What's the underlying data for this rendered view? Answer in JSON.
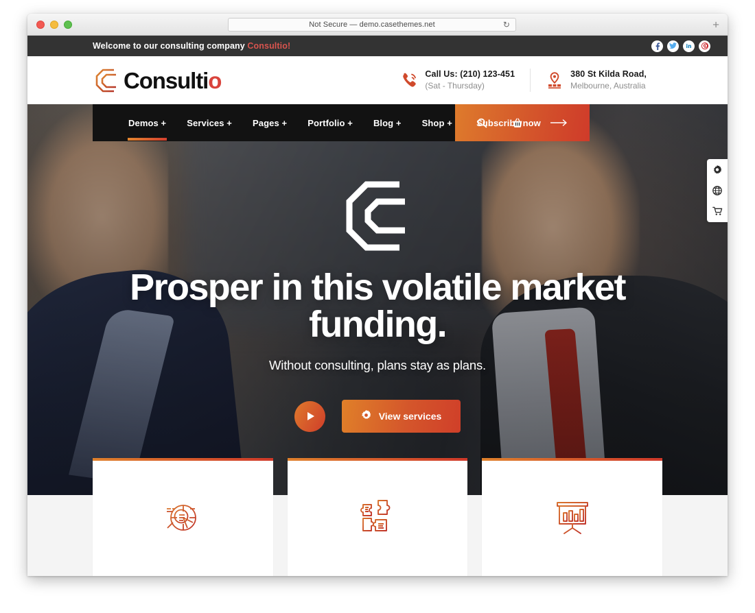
{
  "browser": {
    "url_text": "Not Secure — demo.casethemes.net",
    "reload_icon": "reload-icon",
    "newtab_label": "+",
    "traffic_lights": [
      "close",
      "minimize",
      "zoom"
    ]
  },
  "topbar": {
    "welcome_text": "Welcome to our consulting company ",
    "brand_text": "Consultio!",
    "socials": [
      {
        "name": "facebook",
        "glyph": "f",
        "color": "#3b5998"
      },
      {
        "name": "twitter",
        "glyph": "t",
        "color": "#55acee"
      },
      {
        "name": "linkedin",
        "glyph": "in",
        "color": "#0077b5"
      },
      {
        "name": "pinterest",
        "glyph": "p",
        "color": "#cb2027"
      }
    ]
  },
  "header": {
    "logo_text": "Consulti",
    "logo_text_accent": "o",
    "logo_mark_icon": "consultio-c-monogram-icon",
    "phone": {
      "icon": "phone-ringing-icon",
      "line1": "Call Us: (210) 123-451",
      "line2": "(Sat - Thursday)"
    },
    "address": {
      "icon": "map-pin-icon",
      "line1": "380 St Kilda Road,",
      "line2": "Melbourne, Australia"
    }
  },
  "nav": {
    "items": [
      {
        "label": "Demos +",
        "active": true
      },
      {
        "label": "Services +",
        "active": false
      },
      {
        "label": "Pages +",
        "active": false
      },
      {
        "label": "Portfolio +",
        "active": false
      },
      {
        "label": "Blog +",
        "active": false
      },
      {
        "label": "Shop +",
        "active": false
      }
    ],
    "search_icon": "search-icon",
    "cart_icon": "shopping-basket-icon",
    "subscribe_label": "Subscribe now",
    "subscribe_arrow_icon": "arrow-right-icon"
  },
  "hero": {
    "emblem_icon": "consultio-c-monogram-icon",
    "title": "Prosper in this volatile market funding.",
    "subtitle": "Without consulting, plans stay as plans.",
    "play_button_icon": "play-icon",
    "cta_label": "View services",
    "cta_icon": "gear-icon"
  },
  "cards": [
    {
      "icon": "pie-chart-analysis-icon"
    },
    {
      "icon": "puzzle-pieces-icon"
    },
    {
      "icon": "presentation-bar-chart-icon"
    }
  ],
  "side_tools": [
    {
      "icon": "gear-icon",
      "name": "settings"
    },
    {
      "icon": "globe-icon",
      "name": "language"
    },
    {
      "icon": "cart-icon",
      "name": "cart"
    }
  ],
  "colors": {
    "accent_orange": "#e0822d",
    "accent_red": "#d0392a",
    "dark_bar": "#333333",
    "nav_bg": "#121212",
    "section_bg": "#f4f4f4"
  }
}
